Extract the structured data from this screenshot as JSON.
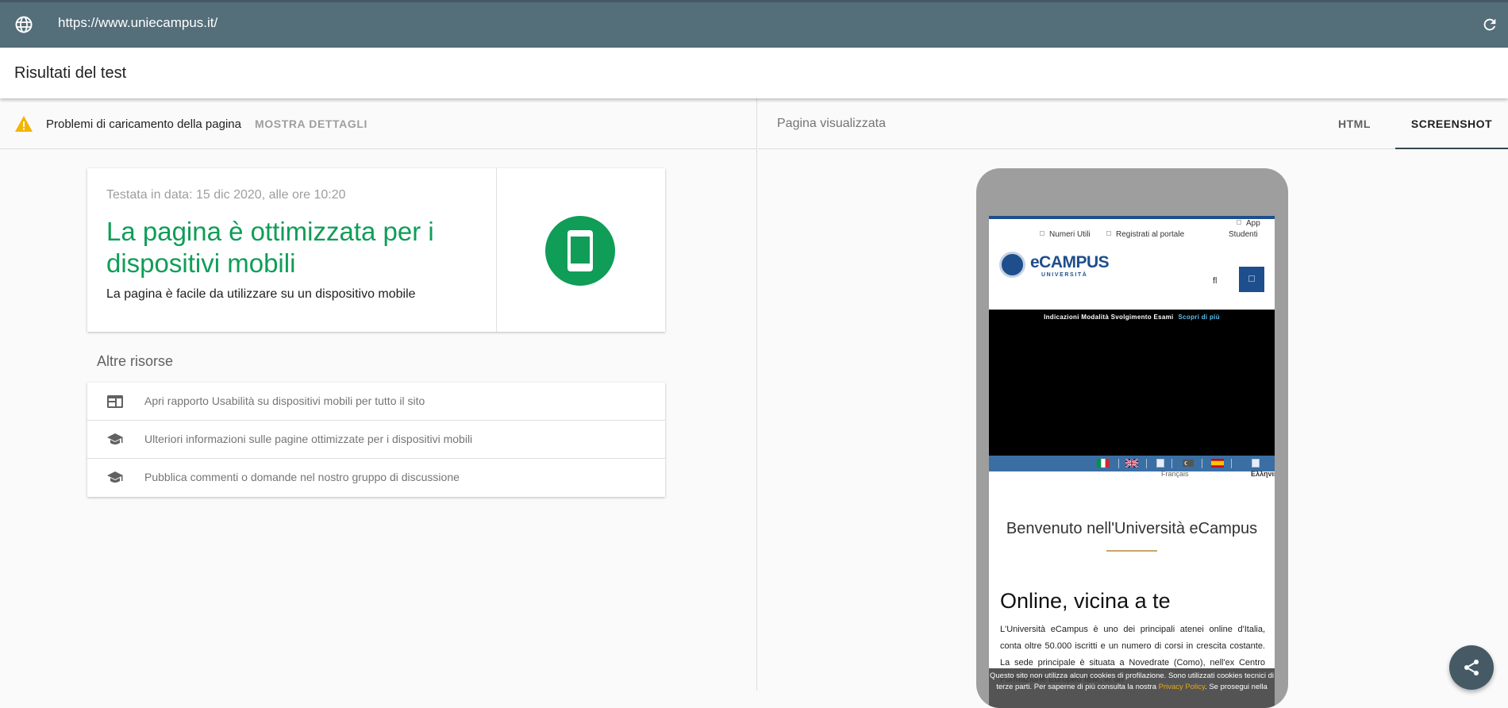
{
  "url_bar": {
    "url": "https://www.uniecampus.it/",
    "globe_icon": "globe-icon",
    "reload_icon": "reload-icon"
  },
  "header": {
    "title": "Risultati del test"
  },
  "left_panel": {
    "warning": {
      "icon": "warning-icon",
      "text": "Problemi di caricamento della pagina",
      "details_label": "MOSTRA DETTAGLI"
    },
    "result": {
      "date": "Testata in data: 15 dic 2020, alle ore 10:20",
      "headline": "La pagina è ottimizzata per i dispositivi mobili",
      "subtext": "La pagina è facile da utilizzare su un dispositivo mobile",
      "badge_icon": "smartphone-icon",
      "accent_color": "#0f9d58"
    },
    "resources": {
      "title": "Altre risorse",
      "items": [
        {
          "icon": "web-report-icon",
          "label": "Apri rapporto Usabilità su dispositivi mobili per tutto il sito"
        },
        {
          "icon": "school-icon",
          "label": "Ulteriori informazioni sulle pagine ottimizzate per i dispositivi mobili"
        },
        {
          "icon": "school-icon",
          "label": "Pubblica commenti o domande nel nostro gruppo di discussione"
        }
      ]
    }
  },
  "right_panel": {
    "label": "Pagina visualizzata",
    "tabs": [
      {
        "label": "HTML",
        "selected": false
      },
      {
        "label": "SCREENSHOT",
        "selected": true
      }
    ],
    "screenshot": {
      "top_links": {
        "numeri": "Numeri Utili",
        "registrati": "Registrati al portale",
        "app": "App",
        "studenti": "Studenti"
      },
      "logo_word": "eCAMPUS",
      "logo_sub": "UNIVERSITÀ",
      "fl_text": "fl",
      "banner_text": "Indicazioni Modalità Svolgimento Esami",
      "banner_link": "Scopri di più",
      "flag_fr": "Français",
      "flag_el": "Ελληνικά",
      "welcome": "Benvenuto nell'Università eCampus",
      "online_title": "Online, vicina a te",
      "paragraph": "L'Università eCampus è uno dei principali atenei online d'Italia, conta oltre 50.000 iscritti e un numero di corsi in crescita costante. La sede principale è situata a Novedrate (Como), nell'ex Centro Formazione Europeo IBM, in un",
      "cookie_text": "Questo sito non utilizza alcun cookies di profilazione. Sono utilizzati cookies tecnici di terze parti. Per saperne di più consulta la nostra",
      "cookie_link": "Privacy Policy",
      "cookie_tail": ". Se prosegui nella"
    }
  },
  "fab": {
    "icon": "share-icon"
  }
}
